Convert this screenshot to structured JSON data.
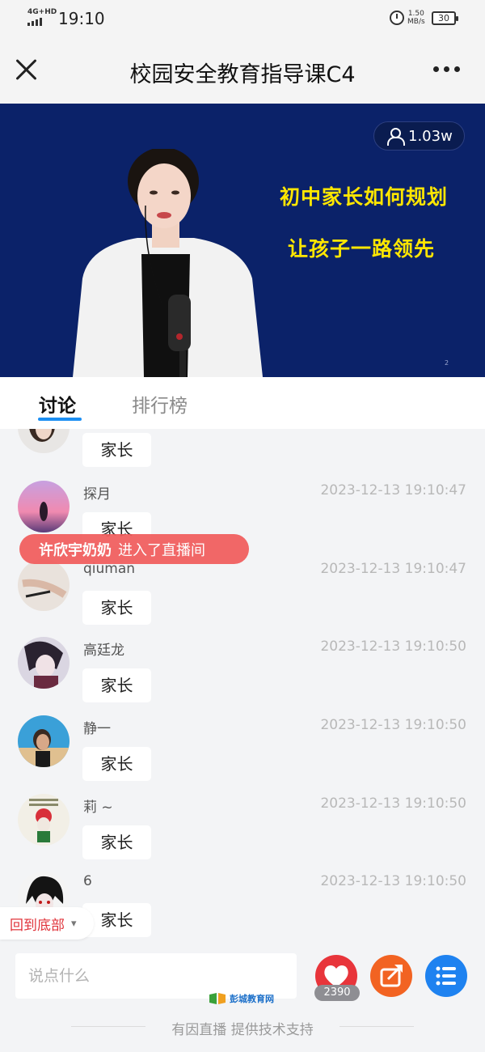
{
  "status_bar": {
    "network": "4G+HD",
    "time": "19:10",
    "speed_value": "1.50",
    "speed_unit": "MB/s",
    "battery": "30"
  },
  "nav": {
    "title": "校园安全教育指导课C4"
  },
  "video": {
    "viewer_count": "1.03w",
    "slide_line1": "初中家长如何规划",
    "slide_line2": "让孩子一路领先",
    "slide_page": "2"
  },
  "tabs": {
    "discuss": "讨论",
    "ranking": "排行榜"
  },
  "messages": [
    {
      "username": "",
      "time": "",
      "text": "家长"
    },
    {
      "username": "探月",
      "time": "2023-12-13 19:10:47",
      "text": "家长"
    },
    {
      "username": "qiuman",
      "time": "2023-12-13 19:10:47",
      "text": "家长"
    },
    {
      "username": "高廷龙",
      "time": "2023-12-13 19:10:50",
      "text": "家长"
    },
    {
      "username": "静一",
      "time": "2023-12-13 19:10:50",
      "text": "家长"
    },
    {
      "username": "莉 ~",
      "time": "2023-12-13 19:10:50",
      "text": "家长"
    },
    {
      "username": "6",
      "time": "2023-12-13 19:10:50",
      "text": "家长"
    }
  ],
  "toast": {
    "name": "许欣宇奶奶",
    "text": "进入了直播间"
  },
  "back_to_bottom": "回到底部",
  "input": {
    "placeholder": "说点什么"
  },
  "like_count": "2390",
  "watermark": "彭城教育网",
  "footer": "有因直播 提供技术支持",
  "colors": {
    "accent_blue": "#1c8ff3",
    "like_red": "#e8353b",
    "share_orange": "#f26322",
    "menu_blue": "#1e82f0",
    "toast_red": "#f15d5d",
    "slide_bg": "#0b2269",
    "slide_text": "#ffe600"
  }
}
